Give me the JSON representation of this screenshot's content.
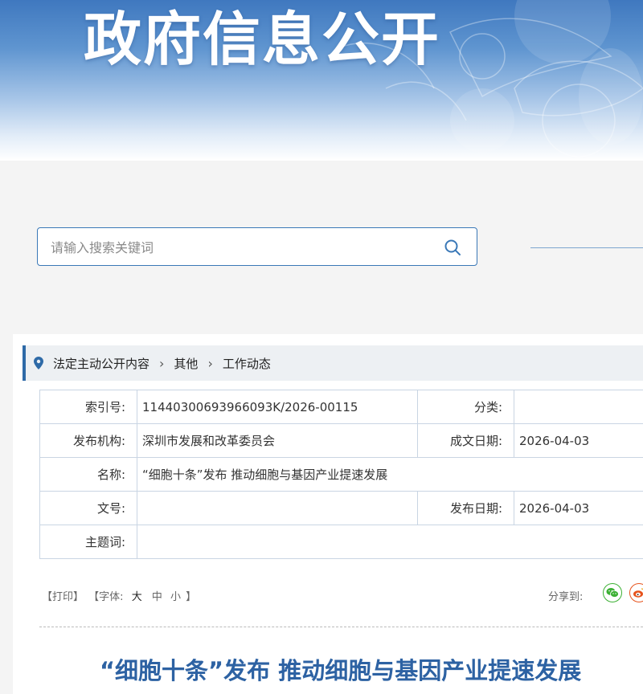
{
  "banner": {
    "title": "政府信息公开"
  },
  "search": {
    "placeholder": "请输入搜索关键词"
  },
  "breadcrumb": {
    "items": [
      "法定主动公开内容",
      "其他",
      "工作动态"
    ]
  },
  "info": {
    "index_label": "索引号:",
    "index_value": "11440300693966093K/2026-00115",
    "category_label": "分类:",
    "category_value": "",
    "publisher_label": "发布机构:",
    "publisher_value": "深圳市发展和改革委员会",
    "written_date_label": "成文日期:",
    "written_date_value": "2026-04-03",
    "name_label": "名称:",
    "name_value": "“细胞十条”发布 推动细胞与基因产业提速发展",
    "doc_no_label": "文号:",
    "doc_no_value": "",
    "publish_date_label": "发布日期:",
    "publish_date_value": "2026-04-03",
    "subject_label": "主题词:",
    "subject_value": ""
  },
  "tools": {
    "print": "【打印】",
    "font_prefix": "【字体:",
    "font_large": "大",
    "font_medium": "中",
    "font_small": "小",
    "font_suffix": "】",
    "share_label": "分享到:"
  },
  "article": {
    "title": "“细胞十条”发布 推动细胞与基因产业提速发展"
  },
  "icons": [
    "pin-icon",
    "search-icon",
    "chevron-right-icon",
    "wechat-icon",
    "weibo-icon"
  ],
  "colors": {
    "accent": "#2e6aa7",
    "title": "#2d62a3",
    "wechat": "#3cb034",
    "weibo": "#e6531d"
  }
}
